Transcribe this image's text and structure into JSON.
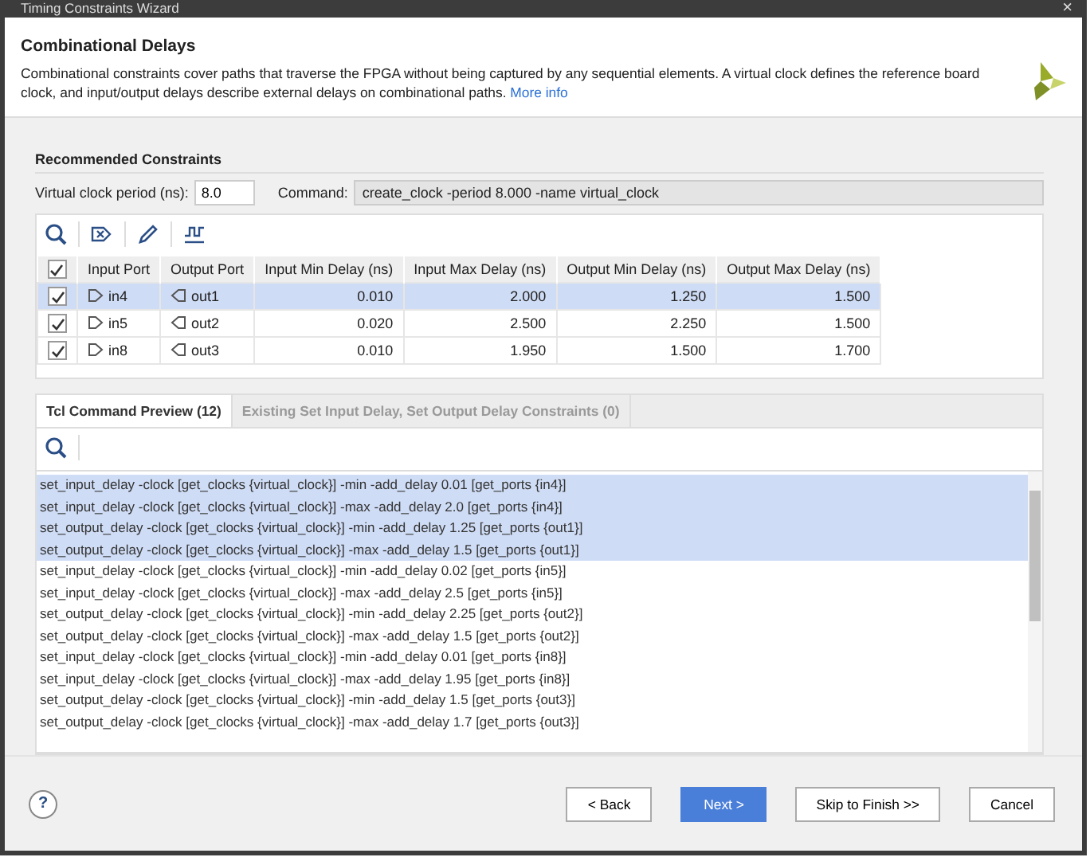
{
  "window": {
    "title": "Timing Constraints Wizard",
    "close": "×"
  },
  "header": {
    "title": "Combinational Delays",
    "description": "Combinational constraints cover paths that traverse the FPGA without being captured by any sequential elements. A virtual clock defines the reference board clock, and input/output delays describe external delays on combinational paths.",
    "link": "More info"
  },
  "section_title": "Recommended Constraints",
  "clock": {
    "label": "Virtual clock period (ns):",
    "value": "8.0",
    "command_label": "Command:",
    "command": "create_clock -period 8.000 -name virtual_clock"
  },
  "table": {
    "header_checked": true,
    "columns": [
      "Input Port",
      "Output Port",
      "Input Min Delay (ns)",
      "Input Max Delay (ns)",
      "Output Min Delay (ns)",
      "Output Max Delay (ns)"
    ],
    "rows": [
      {
        "checked": true,
        "selected": true,
        "cells": [
          "in4",
          "out1",
          "0.010",
          "2.000",
          "1.250",
          "1.500"
        ]
      },
      {
        "checked": true,
        "selected": false,
        "cells": [
          "in5",
          "out2",
          "0.020",
          "2.500",
          "2.250",
          "1.500"
        ]
      },
      {
        "checked": true,
        "selected": false,
        "cells": [
          "in8",
          "out3",
          "0.010",
          "1.950",
          "1.500",
          "1.700"
        ]
      }
    ]
  },
  "tabs": [
    {
      "label": "Tcl Command Preview (12)",
      "selected": true
    },
    {
      "label": "Existing Set Input Delay, Set Output Delay Constraints (0)",
      "selected": false
    }
  ],
  "log": [
    {
      "text": "set_input_delay -clock [get_clocks {virtual_clock}] -min -add_delay 0.01 [get_ports {in4}]",
      "selected": true
    },
    {
      "text": "set_input_delay -clock [get_clocks {virtual_clock}] -max -add_delay 2.0 [get_ports {in4}]",
      "selected": true
    },
    {
      "text": "set_output_delay -clock [get_clocks {virtual_clock}] -min -add_delay 1.25 [get_ports {out1}]",
      "selected": true
    },
    {
      "text": "set_output_delay -clock [get_clocks {virtual_clock}] -max -add_delay 1.5 [get_ports {out1}]",
      "selected": true
    },
    {
      "text": "set_input_delay -clock [get_clocks {virtual_clock}] -min -add_delay 0.02 [get_ports {in5}]",
      "selected": false
    },
    {
      "text": "set_input_delay -clock [get_clocks {virtual_clock}] -max -add_delay 2.5 [get_ports {in5}]",
      "selected": false
    },
    {
      "text": "set_output_delay -clock [get_clocks {virtual_clock}] -min -add_delay 2.25 [get_ports {out2}]",
      "selected": false
    },
    {
      "text": "set_output_delay -clock [get_clocks {virtual_clock}] -max -add_delay 1.5 [get_ports {out2}]",
      "selected": false
    },
    {
      "text": "set_input_delay -clock [get_clocks {virtual_clock}] -min -add_delay 0.01 [get_ports {in8}]",
      "selected": false
    },
    {
      "text": "set_input_delay -clock [get_clocks {virtual_clock}] -max -add_delay 1.95 [get_ports {in8}]",
      "selected": false
    },
    {
      "text": "set_output_delay -clock [get_clocks {virtual_clock}] -min -add_delay 1.5 [get_ports {out3}]",
      "selected": false
    },
    {
      "text": "set_output_delay -clock [get_clocks {virtual_clock}] -max -add_delay 1.7 [get_ports {out3}]",
      "selected": false
    }
  ],
  "buttons": [
    {
      "label": "< Back",
      "kind": "normal"
    },
    {
      "label": "Next >",
      "kind": "primary"
    },
    {
      "label": "Skip to Finish >>",
      "kind": "normal"
    },
    {
      "label": "Cancel",
      "kind": "normal"
    }
  ],
  "help": "?"
}
